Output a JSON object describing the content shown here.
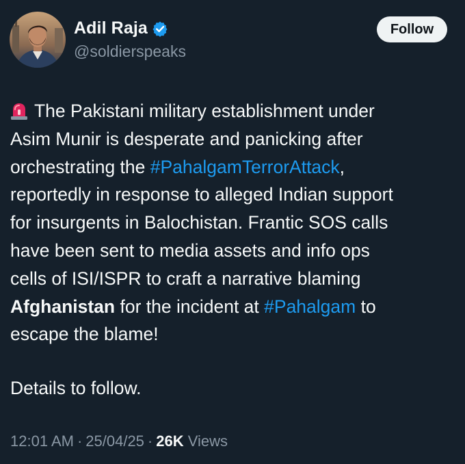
{
  "author": {
    "display_name": "Adil Raja",
    "handle": "@soldierspeaks",
    "verified": true
  },
  "follow_label": "Follow",
  "body": {
    "line1_text": "The Pakistani military establishment under",
    "line2_text": "Asim Munir is desperate and panicking after",
    "line3_pre": "orchestrating the ",
    "line3_hashtag": "#PahalgamTerrorAttack",
    "line3_post": ",",
    "line4_text": "reportedly in response to alleged Indian support",
    "line5_text": "for insurgents in Balochistan. Frantic SOS calls",
    "line6_text": "have been sent to media assets and info ops",
    "line7_text": "cells of ISI/ISPR to craft a narrative blaming",
    "line8_bold": "Afghanistan",
    "line8_mid": " for the incident at ",
    "line8_hashtag": "#Pahalgam",
    "line8_post": " to",
    "line9_text": "escape the blame!",
    "details_text": "Details to follow."
  },
  "meta": {
    "time": "12:01 AM",
    "separator": "·",
    "date": "25/04/25",
    "views_count": "26K",
    "views_label": "Views"
  },
  "icons": {
    "leading_emoji": "siren-icon",
    "verified": "verified-badge-icon"
  },
  "colors": {
    "background": "#15202b",
    "text": "#f7f9f9",
    "secondary_text": "#8b98a5",
    "link": "#1d9bf0",
    "verified": "#1d9bf0",
    "follow_bg": "#eff3f4"
  }
}
